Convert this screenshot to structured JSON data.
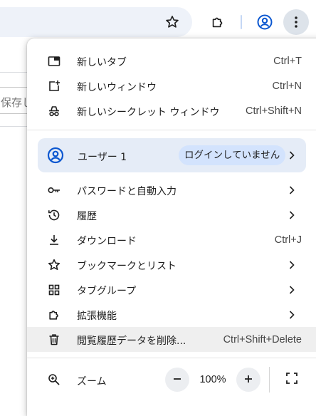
{
  "toolbar": {
    "bookmark_icon": "star-outline-icon",
    "extensions_icon": "puzzle-icon",
    "profile_icon": "account-circle-icon",
    "menu_icon": "vertical-dots-icon"
  },
  "page": {
    "field_text": "保存し"
  },
  "menu": {
    "items_top": [
      {
        "label": "新しいタブ",
        "shortcut": "Ctrl+T",
        "icon": "new-tab-icon"
      },
      {
        "label": "新しいウィンドウ",
        "shortcut": "Ctrl+N",
        "icon": "new-window-icon"
      },
      {
        "label": "新しいシークレット ウィンドウ",
        "shortcut": "Ctrl+Shift+N",
        "icon": "incognito-icon"
      }
    ],
    "profile": {
      "name": "ユーザー 1",
      "status": "ログインしていません",
      "icon": "account-circle-icon"
    },
    "items_mid": [
      {
        "label": "パスワードと自動入力",
        "icon": "key-icon"
      },
      {
        "label": "履歴",
        "icon": "history-icon"
      },
      {
        "label": "ダウンロード",
        "shortcut": "Ctrl+J",
        "icon": "download-icon"
      },
      {
        "label": "ブックマークとリスト",
        "icon": "star-icon"
      },
      {
        "label": "タブグループ",
        "icon": "tab-groups-icon"
      },
      {
        "label": "拡張機能",
        "icon": "puzzle-icon"
      },
      {
        "label": "閲覧履歴データを削除...",
        "shortcut": "Ctrl+Shift+Delete",
        "icon": "trash-icon"
      }
    ],
    "zoom": {
      "label": "ズーム",
      "value": "100%",
      "minus": "−",
      "plus": "+",
      "icon": "zoom-icon"
    }
  },
  "colors": {
    "accent_blue": "#0b57d0",
    "profile_bg": "#e5ecf7",
    "pill_bg": "#d3e3fd",
    "highlight_row": "#efefef"
  }
}
